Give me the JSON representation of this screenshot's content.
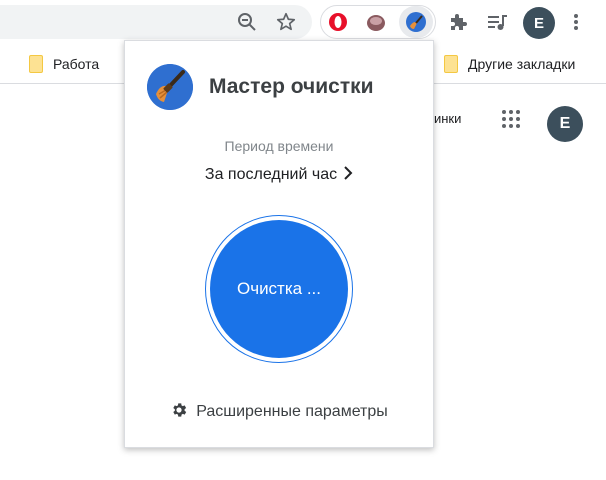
{
  "browser": {
    "colors": {
      "accent": "#1a73e8",
      "profile": "#3c4f5c"
    },
    "toolbar": {
      "icons": [
        "zoom-out-icon",
        "bookmark-star-icon",
        "opera-extension-icon",
        "extension-icon-2",
        "cleaner-extension-icon",
        "extensions-puzzle-icon",
        "media-control-icon",
        "profile-avatar",
        "menu-icon"
      ],
      "profile_initial": "E"
    },
    "bookmarks": {
      "left": "Работа",
      "right": "Другие закладки"
    },
    "page": {
      "link_partial": "тинки",
      "avatar_initial": "E"
    }
  },
  "popup": {
    "title": "Мастер очистки",
    "period_label": "Период времени",
    "period_value": "За последний час",
    "clean_button": "Очистка ...",
    "advanced_label": "Расширенные параметры"
  }
}
